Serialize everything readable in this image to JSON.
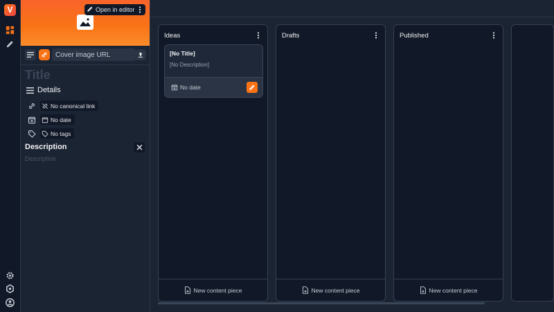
{
  "app": {
    "logo_letter": "V"
  },
  "rail": {
    "icons": [
      "dashboard-icon",
      "pencil-icon",
      "gear-icon",
      "hexagon-icon",
      "account-icon"
    ]
  },
  "side_panel": {
    "open_in_editor_label": "Open in editor",
    "cover_image_placeholder": "Cover image URL",
    "title_placeholder": "Title",
    "details_label": "Details",
    "canonical_link": "No canonical link",
    "date": "No date",
    "tags": "No tags",
    "description_label": "Description",
    "description_placeholder": "Description"
  },
  "board": {
    "columns": [
      {
        "title": "Ideas",
        "footer": "New content piece"
      },
      {
        "title": "Drafts",
        "footer": "New content piece"
      },
      {
        "title": "Published",
        "footer": "New content piece"
      }
    ],
    "card": {
      "title": "[No Title]",
      "description": "[No Description]",
      "date": "No date"
    }
  },
  "colors": {
    "accent": "#f97316",
    "background": "#1b2433",
    "column_bg": "#111827"
  }
}
